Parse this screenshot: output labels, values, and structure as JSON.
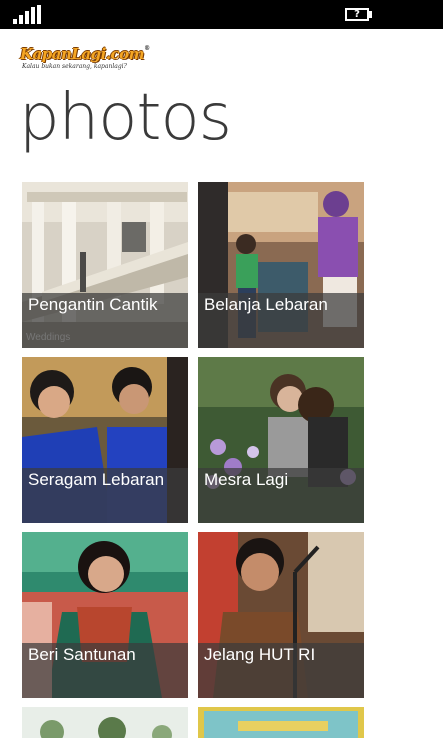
{
  "status_bar": {
    "signal_icon": "signal-strength-icon",
    "battery_icon": "battery-unknown-icon",
    "battery_text": "?"
  },
  "logo": {
    "main": "KapanLagi.com",
    "registered": "®",
    "tagline": "Kalau bukan sekarang, kapanlagi?"
  },
  "page_title": "photos",
  "tiles": [
    {
      "label": "Pengantin Cantik",
      "sublabel": "Weddings"
    },
    {
      "label": "Belanja Lebaran"
    },
    {
      "label": "Seragam Lebaran"
    },
    {
      "label": "Mesra Lagi"
    },
    {
      "label": "Beri Santunan"
    },
    {
      "label": "Jelang HUT RI"
    },
    {
      "label": ""
    },
    {
      "label": ""
    }
  ],
  "colors": {
    "background": "#ffffff",
    "status_bar": "#000000",
    "title": "#3a3a3a",
    "label_overlay": "#3c3c3c",
    "logo_orange": "#f5a623"
  }
}
